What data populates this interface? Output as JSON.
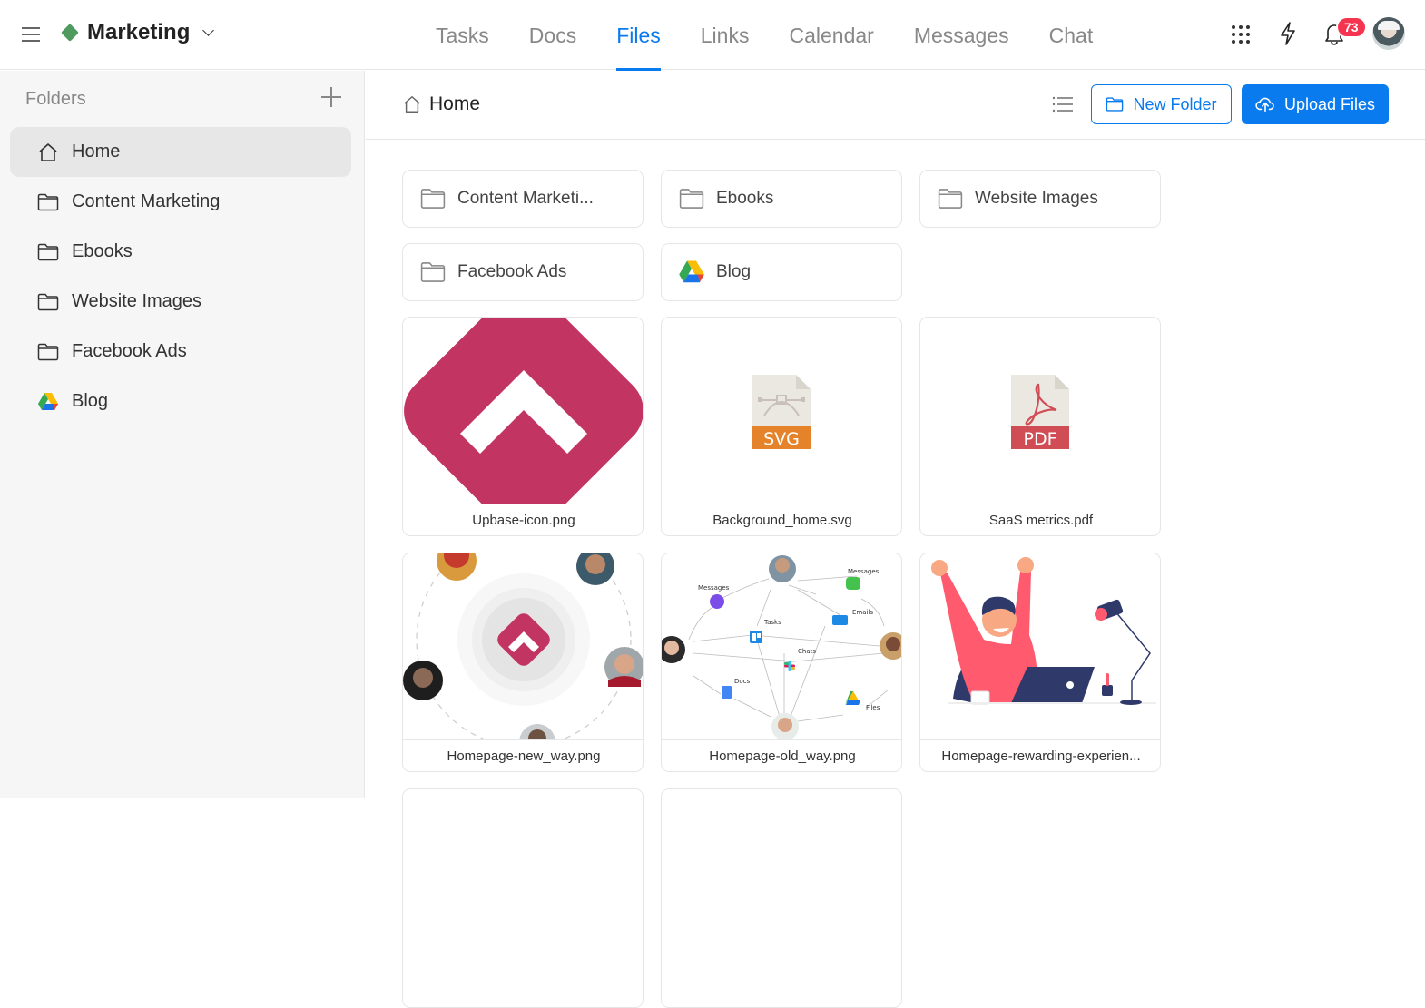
{
  "workspace": {
    "name": "Marketing",
    "color": "#4f9a5f"
  },
  "nav": {
    "tabs": [
      {
        "label": "Tasks",
        "active": false
      },
      {
        "label": "Docs",
        "active": false
      },
      {
        "label": "Files",
        "active": true
      },
      {
        "label": "Links",
        "active": false
      },
      {
        "label": "Calendar",
        "active": false
      },
      {
        "label": "Messages",
        "active": false
      },
      {
        "label": "Chat",
        "active": false
      }
    ]
  },
  "header_icons": {
    "apps": "apps-grid-icon",
    "quick": "lightning-icon",
    "notifications": "bell-icon",
    "notification_count": "73"
  },
  "sidebar": {
    "title": "Folders",
    "add_icon": "plus-icon",
    "items": [
      {
        "label": "Home",
        "icon": "home-icon",
        "active": true
      },
      {
        "label": "Content Marketing",
        "icon": "folder-icon"
      },
      {
        "label": "Ebooks",
        "icon": "folder-icon"
      },
      {
        "label": "Website Images",
        "icon": "folder-icon"
      },
      {
        "label": "Facebook Ads",
        "icon": "folder-icon"
      },
      {
        "label": "Blog",
        "icon": "google-drive-icon"
      }
    ]
  },
  "main": {
    "breadcrumb": "Home",
    "new_folder_label": "New Folder",
    "upload_label": "Upload Files",
    "folders": [
      {
        "label": "Content Marketi...",
        "icon": "folder-icon"
      },
      {
        "label": "Ebooks",
        "icon": "folder-icon"
      },
      {
        "label": "Website Images",
        "icon": "folder-icon"
      },
      {
        "label": "Facebook Ads",
        "icon": "folder-icon"
      },
      {
        "label": "Blog",
        "icon": "google-drive-icon"
      }
    ],
    "files": [
      {
        "name": "Upbase-icon.png",
        "thumb": "upbase-logo"
      },
      {
        "name": "Background_home.svg",
        "thumb": "svg-file-icon",
        "badge": "SVG",
        "badge_color": "#e5832a"
      },
      {
        "name": "SaaS metrics.pdf",
        "thumb": "pdf-file-icon",
        "badge": "PDF",
        "badge_color": "#d14d55"
      },
      {
        "name": "Homepage-new_way.png",
        "thumb": "new-way-illustration"
      },
      {
        "name": "Homepage-old_way.png",
        "thumb": "old-way-diagram",
        "labels": [
          "Messages",
          "Messages",
          "Emails",
          "Tasks",
          "Chats",
          "Docs",
          "Files"
        ]
      },
      {
        "name": "Homepage-rewarding-experien...",
        "thumb": "celebration-illustration"
      }
    ]
  },
  "colors": {
    "accent": "#0a7aef",
    "badge": "#f5344f",
    "brand_pink": "#c23563"
  }
}
